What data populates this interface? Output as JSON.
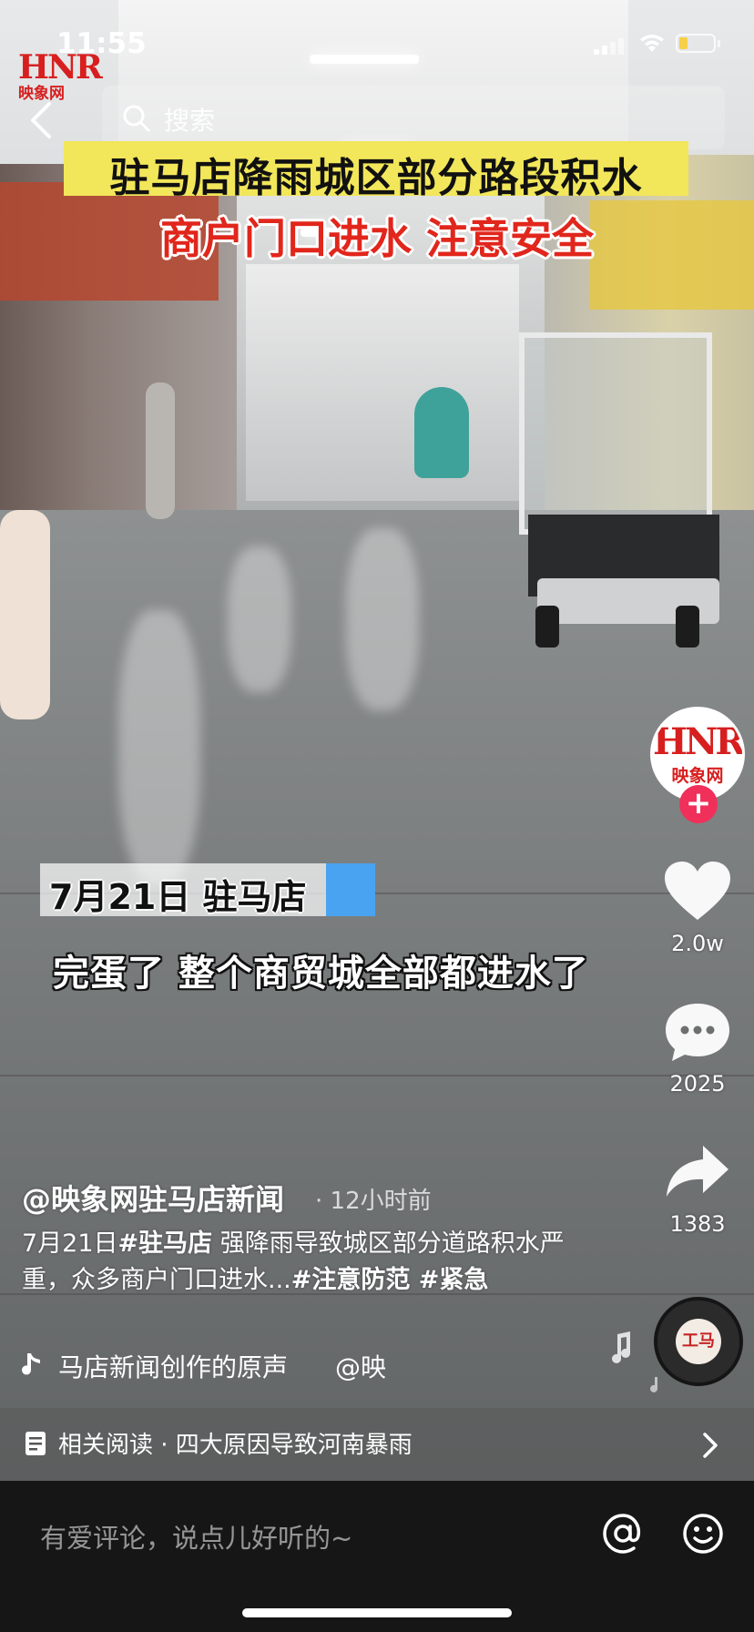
{
  "status_bar": {
    "time": "11:55",
    "battery_level": 0.25,
    "battery_color": "#f6d047"
  },
  "watermark": {
    "logo": "HNR",
    "name": "映象网"
  },
  "search": {
    "placeholder": "搜索"
  },
  "video": {
    "headline_line1": "驻马店降雨城区部分路段积水",
    "headline_line2": "商户门口进水 注意安全",
    "headline_bg": "#f2e65a",
    "headline2_color": "#e1261c",
    "date_caption": "7月21日 驻马店",
    "subtitle": "完蛋了 整个商贸城全部都进水了"
  },
  "actions": {
    "avatar_logo": "HNR",
    "avatar_name": "映象网",
    "follow_symbol": "+",
    "likes": "2.0w",
    "comments": "2025",
    "shares": "1383",
    "follow_color": "#f0305a"
  },
  "post": {
    "author": "@映象网驻马店新闻",
    "time": "· 12小时前",
    "desc_text1": "7月21日",
    "desc_tag1": "#驻马店",
    "desc_text2": " 强降雨导致城区部分道路积水严重，众多商户门口进水...",
    "desc_tag2": "#注意防范",
    "desc_tag3": " #紧急",
    "music_title": "马店新闻创作的原声",
    "music_author": "@映",
    "disc_label": "工马"
  },
  "related": {
    "label": "相关阅读 · 四大原因导致河南暴雨"
  },
  "comment_bar": {
    "placeholder": "有爱评论，说点儿好听的~"
  }
}
